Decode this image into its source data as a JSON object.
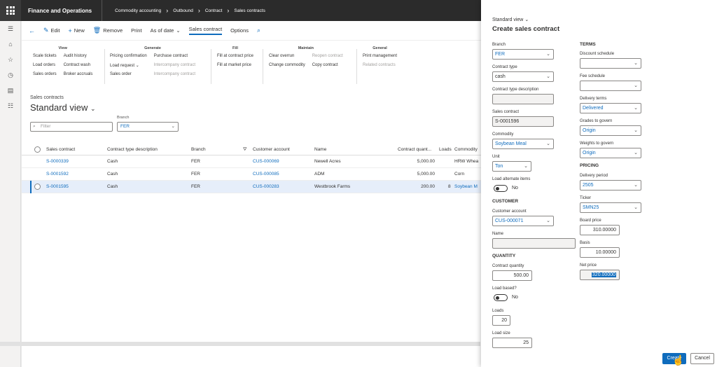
{
  "topbar": {
    "app_title": "Finance and Operations",
    "breadcrumbs": [
      "Commodity accounting",
      "Outbound",
      "Contract",
      "Sales contracts"
    ]
  },
  "actions": {
    "edit": "Edit",
    "new": "New",
    "remove": "Remove",
    "print": "Print",
    "as_of_date": "As of date",
    "sales_contract": "Sales contract",
    "options": "Options"
  },
  "ribbon": {
    "view": {
      "title": "View",
      "col1": [
        "Scale tickets",
        "Load orders",
        "Sales orders"
      ],
      "col2": [
        "Audit history",
        "Contract wash",
        "Broker accruals"
      ]
    },
    "generate": {
      "title": "Generate",
      "col1": [
        "Pricing confirmation",
        "Load request",
        "Sales order"
      ],
      "col2": [
        "Purchase contract",
        "Intercompany contract",
        "Intercompany contract"
      ]
    },
    "fill": {
      "title": "Fill",
      "col1": [
        "Fill at contract price",
        "Fill at market price"
      ]
    },
    "maintain": {
      "title": "Maintain",
      "col1": [
        "Clear overrun",
        "Change commodity"
      ],
      "col2": [
        "Reopen contract",
        "Copy contract"
      ]
    },
    "general": {
      "title": "General",
      "col1": [
        "Print management",
        "Related contracts"
      ]
    }
  },
  "list": {
    "caption": "Sales contracts",
    "view_name": "Standard view",
    "filter_placeholder": "Filter",
    "branch_label": "Branch",
    "branch_value": "FER",
    "columns": [
      "Sales contract",
      "Contract type description",
      "Branch",
      "Customer account",
      "Name",
      "Contract quant...",
      "Loads",
      "Commodity"
    ],
    "rows": [
      {
        "contract": "S-0000339",
        "type": "Cash",
        "branch": "FER",
        "account": "CUS-000069",
        "name": "Newell Acres",
        "qty": "5,000.00",
        "loads": "",
        "commodity": "HRW Whea"
      },
      {
        "contract": "S-0001592",
        "type": "Cash",
        "branch": "FER",
        "account": "CUS-000085",
        "name": "ADM",
        "qty": "5,000.00",
        "loads": "",
        "commodity": "Corn"
      },
      {
        "contract": "S-0001595",
        "type": "Cash",
        "branch": "FER",
        "account": "CUS-000283",
        "name": "Westbrook Farms",
        "qty": "200.00",
        "loads": "8",
        "commodity": "Soybean M"
      }
    ]
  },
  "panel": {
    "view": "Standard view",
    "title": "Create sales contract",
    "branch_label": "Branch",
    "branch": "FER",
    "contract_type_label": "Contract type",
    "contract_type": "cash",
    "contract_type_desc_label": "Contract type description",
    "contract_type_desc": "",
    "sales_contract_label": "Sales contract",
    "sales_contract": "S-0001596",
    "commodity_label": "Commodity",
    "commodity": "Soybean Meal",
    "unit_label": "Unit",
    "unit": "Ton",
    "load_alt_label": "Load alternate items",
    "load_alt_value": "No",
    "customer_header": "CUSTOMER",
    "customer_account_label": "Customer account",
    "customer_account": "CUS-000071",
    "name_label": "Name",
    "name": "",
    "quantity_header": "QUANTITY",
    "contract_qty_label": "Contract quantity",
    "contract_qty": "500.00",
    "load_based_label": "Load based?",
    "load_based_value": "No",
    "loads_label": "Loads",
    "loads": "20",
    "load_size_label": "Load size",
    "load_size": "25",
    "terms_header": "TERMS",
    "discount_label": "Discount schedule",
    "discount": "",
    "fee_label": "Fee schedule",
    "fee": "",
    "delivery_terms_label": "Delivery terms",
    "delivery_terms": "Delivered",
    "grades_label": "Grades to govern",
    "grades": "Origin",
    "weights_label": "Weights to govern",
    "weights": "Origin",
    "pricing_header": "PRICING",
    "delivery_period_label": "Delivery period",
    "delivery_period": "2505",
    "ticker_label": "Ticker",
    "ticker": "SMN25",
    "board_price_label": "Board price",
    "board_price": "310.00000",
    "basis_label": "Basis",
    "basis": "10.00000",
    "net_price_label": "Net price",
    "net_price": "320.00000",
    "create_button": "Create",
    "cancel_button": "Cancel"
  }
}
